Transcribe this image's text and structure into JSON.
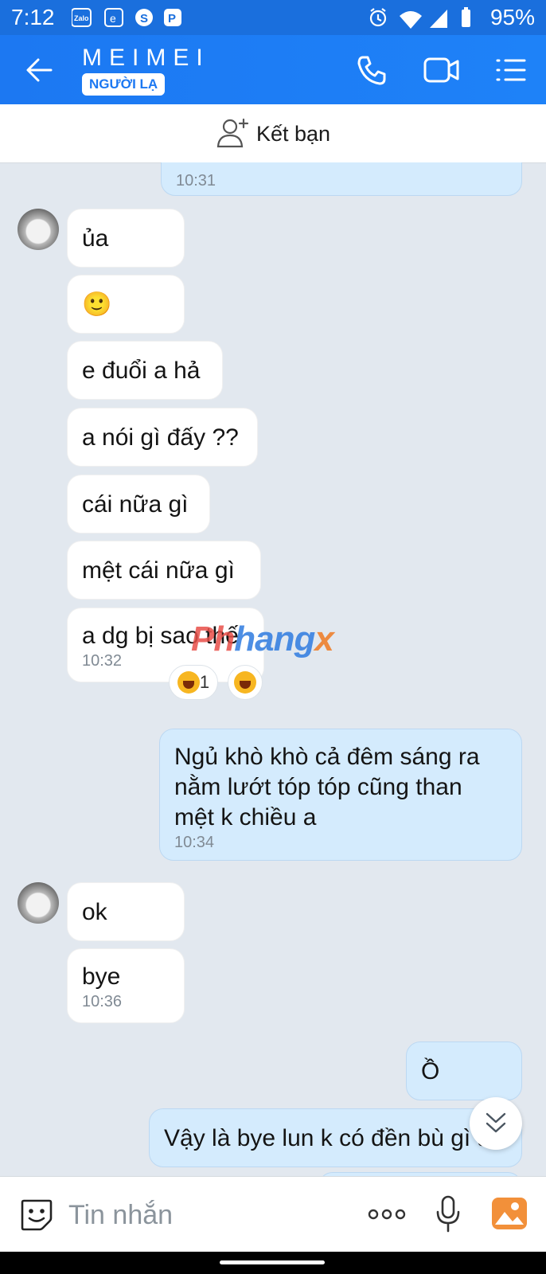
{
  "status_bar": {
    "time": "7:12",
    "notification_icons": [
      "zalo-icon",
      "edge-icon",
      "skype-icon",
      "p-app-icon"
    ],
    "battery": "95%"
  },
  "header": {
    "contact_name": "MEIMEI",
    "badge": "NGƯỜI LẠ"
  },
  "add_friend": {
    "label": "Kết bạn"
  },
  "messages": [
    {
      "side": "out",
      "text": "",
      "time": "10:31"
    },
    {
      "side": "in",
      "text": " ủa",
      "time": ""
    },
    {
      "side": "in",
      "text": "🙂",
      "time": ""
    },
    {
      "side": "in",
      "text": "e đuổi a hả",
      "time": ""
    },
    {
      "side": "in",
      "text": "a nói gì đấy ??",
      "time": ""
    },
    {
      "side": "in",
      "text": "cái nữa gì",
      "time": ""
    },
    {
      "side": "in",
      "text": "mệt cái nữa gì",
      "time": ""
    },
    {
      "side": "in",
      "text": "a dg bị sao thế",
      "time": "10:32"
    },
    {
      "side": "out",
      "lines": [
        "Ngủ khò khò cả đêm sáng ra",
        "nằm lướt tóp tóp cũng than",
        "mệt k chiều a"
      ],
      "time": "10:34"
    },
    {
      "side": "in",
      "text": "ok",
      "time": ""
    },
    {
      "side": "in",
      "text": "bye",
      "time": "10:36"
    },
    {
      "side": "out",
      "text": "Ồ",
      "time": ""
    },
    {
      "side": "out",
      "text": "Vậy là bye lun k có đền bù gì à",
      "time": ""
    }
  ],
  "reactions": {
    "count": "1"
  },
  "watermark": {
    "part1": "Ph",
    "part2": "hang",
    "part3": "x"
  },
  "input": {
    "placeholder": "Tin nhắn"
  },
  "colors": {
    "header": "#1c78f2",
    "bubble_out": "#d4ebfd",
    "bubble_in": "#ffffff",
    "background": "#e2e8ef"
  }
}
